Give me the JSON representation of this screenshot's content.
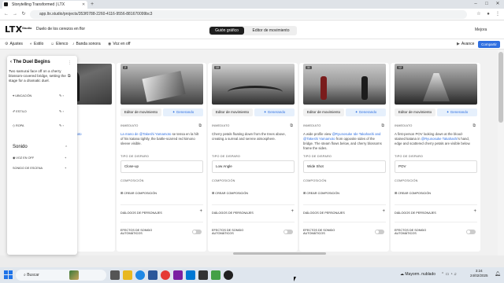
{
  "browser": {
    "tab_title": "Storytelling Transformed | LTX",
    "url": "app.ltx.studio/projects/353f0788-2260-4116-9556-881670099bc3"
  },
  "app": {
    "logo": "LTX",
    "logo_sub": "Studio",
    "project_title": "Duelo de los cerezos en flor",
    "mode_tabs": [
      "Guión gráfico",
      "Editor de movimiento"
    ],
    "user": "Mejora"
  },
  "toolbar": {
    "items": [
      "Ajustes",
      "Estilo",
      "Elenco",
      "Banda sonora",
      "Voz en off"
    ],
    "preview": "Avance",
    "share": "Compartir"
  },
  "panel": {
    "title": "The Duel Begins",
    "description": "Two samurai face off on a cherry blossom-covered bridge, setting the stage for a dramatic duel.",
    "rows": [
      "UBICACIÓN",
      "ESTILO",
      "ROPA"
    ],
    "sound_header": "Sonido",
    "sound_rows": [
      "VOZ EN OFF",
      "SONIDO DE ESCENA"
    ]
  },
  "labels": {
    "editor": "Editor de movimiento",
    "generating": "Generando",
    "prompt": "INMEDIATO",
    "shot_type": "TIPO DE DISPARO",
    "composition": "COMPOSICIÓN",
    "create_composition": "CREAR COMPOSICIÓN",
    "dialogues": "DIÁLOGOS DE PERSONAJES",
    "sfx": "EFECTOS DE SONIDO AUTOMÁTICOS"
  },
  "cards": [
    {
      "number": "1",
      "prompt_parts": [
        "Takeshi all fo",
        "@Takeshi Yamamoto"
      ],
      "shot": ""
    },
    {
      "number": "2",
      "prompt_parts": [
        "La mano de @Takeshi Yamamoto",
        " se tensa en la hilt of his katana tightly, the battle-scarred red kimono sleeve visible."
      ],
      "shot": "Close-up"
    },
    {
      "number": "10",
      "prompt_parts": [
        "Cherry petals floating down from the trees above, creating a surreal and serene atmosphere.",
        ""
      ],
      "shot": "Low Angle"
    },
    {
      "number": "11",
      "prompt_parts": [
        "A wide profile view",
        "@Ryunosuke Ide Takahashi and @Takeshi Yamamoto",
        "from opposite sides of the bridge. The steam flows below, and cherry blossoms frame the sides."
      ],
      "shot": "Wide Shot"
    },
    {
      "number": "12",
      "prompt_parts": [
        "A first-person POV looking down at the blood-stained katana in",
        "@Ryunosuke Takahashi",
        "'s hand, edge and scattered cherry petals are visible below."
      ],
      "shot": "POV"
    }
  ],
  "taskbar": {
    "search": "Buscar",
    "weather": "Mayorm. nublado",
    "time": "3:24",
    "date": "24/02/2025"
  }
}
